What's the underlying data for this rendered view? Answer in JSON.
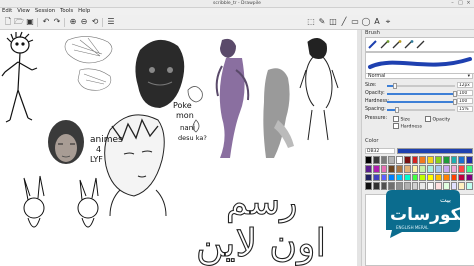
{
  "window": {
    "title": "scribble_tr - Drawpile"
  },
  "menu": [
    "Edit",
    "View",
    "Session",
    "Tools",
    "Help"
  ],
  "brush_panel": {
    "header": "Brush",
    "preset": "Normal",
    "size": {
      "label": "Size:",
      "value": "12px",
      "level": 0.12
    },
    "opacity": {
      "label": "Opacity:",
      "value": "100",
      "level": 1.0
    },
    "hardness": {
      "label": "Hardness:",
      "value": "100",
      "level": 1.0
    },
    "spacing": {
      "label": "Spacing:",
      "value": "15%",
      "level": 0.15
    },
    "pressure": {
      "label": "Pressure:",
      "size": "Size",
      "opacity": "Opacity",
      "hardness": "Hardness"
    }
  },
  "color_panel": {
    "header": "Color",
    "hex": "DB32",
    "current_color": "#1e40b0",
    "palette": [
      "#000000",
      "#3a3a3a",
      "#7a7a7a",
      "#b5b5b5",
      "#ffffff",
      "#7a1010",
      "#d61f1f",
      "#f07a1e",
      "#f5d21a",
      "#8ad11d",
      "#1d9c3a",
      "#1db0b0",
      "#1d6fd1",
      "#1d2ea8",
      "#5a1d8f",
      "#b01db0",
      "#e86fb4",
      "#6b4420",
      "#a87442",
      "#e0b27a",
      "#fff2a8",
      "#c7f0a8",
      "#a8f0e0",
      "#a8c8f0",
      "#c8a8f0",
      "#f0a8d8",
      "#ff4444",
      "#44ff88",
      "#202060",
      "#4040c0",
      "#6060ff",
      "#0080ff",
      "#00c0ff",
      "#00ffd0",
      "#40ff40",
      "#c0ff00",
      "#ffff00",
      "#ffc000",
      "#ff8000",
      "#ff4000",
      "#c00040",
      "#800080",
      "#101010",
      "#303030",
      "#505050",
      "#707070",
      "#909090",
      "#b0b0b0",
      "#d0d0d0",
      "#e8e8e8",
      "#f8f8f8",
      "#ffe0e0",
      "#e0ffe0",
      "#e0e0ff",
      "#fff0c0",
      "#c0fff0"
    ]
  },
  "canvas_text": {
    "note1": "Poke",
    "note2": "mon",
    "note3": "nani",
    "note4": "desu ka?",
    "note5": "animes",
    "note6": "4",
    "note7": "LYF",
    "arabic1": "رسم",
    "arabic2": "اون لاين"
  },
  "watermark": {
    "brand": "لكورسات",
    "small": "بيت",
    "latin": "ENGLISH MERAL"
  }
}
